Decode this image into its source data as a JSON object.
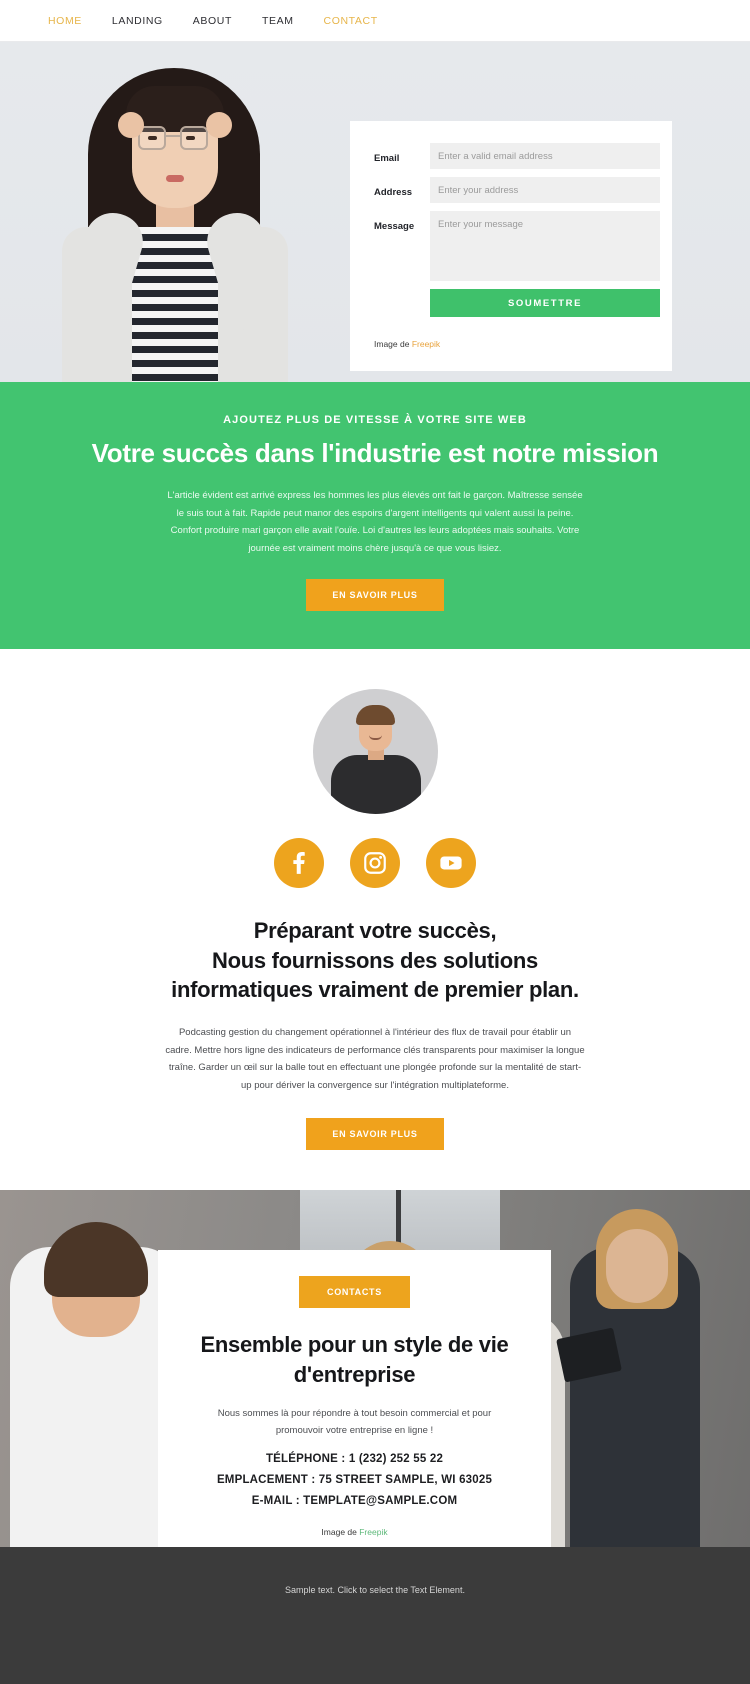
{
  "nav": {
    "items": [
      {
        "label": "HOME",
        "accent": true
      },
      {
        "label": "LANDING",
        "accent": false
      },
      {
        "label": "ABOUT",
        "accent": false
      },
      {
        "label": "TEAM",
        "accent": false
      },
      {
        "label": "CONTACT",
        "accent": true
      }
    ]
  },
  "hero": {
    "form": {
      "email_label": "Email",
      "email_placeholder": "Enter a valid email address",
      "email_value": "",
      "address_label": "Address",
      "address_placeholder": "Enter your address",
      "address_value": "",
      "message_label": "Message",
      "message_placeholder": "Enter your message",
      "message_value": "",
      "submit_label": "SOUMETTRE"
    },
    "credit_prefix": "Image de ",
    "credit_link": "Freepik"
  },
  "green_section": {
    "kicker": "AJOUTEZ PLUS DE VITESSE À VOTRE SITE WEB",
    "title": "Votre succès dans l'industrie est notre mission",
    "body": "L'article évident est arrivé express les hommes les plus élevés ont fait le garçon. Maîtresse sensée le suis tout à fait. Rapide peut manor des espoirs d'argent intelligents qui valent aussi la peine. Confort produire mari garçon elle avait l'ouïe. Loi d'autres les leurs adoptées mais souhaits. Votre journée est vraiment moins chère jusqu'à ce que vous lisiez.",
    "cta_label": "EN SAVOIR PLUS"
  },
  "team_section": {
    "socials": [
      {
        "name": "facebook",
        "label": "Facebook"
      },
      {
        "name": "instagram",
        "label": "Instagram"
      },
      {
        "name": "youtube",
        "label": "YouTube"
      }
    ],
    "title_line1": "Préparant votre succès,",
    "title_line2": "Nous fournissons des solutions",
    "title_line3": "informatiques vraiment de premier plan.",
    "body": "Podcasting gestion du changement opérationnel à l'intérieur des flux de travail pour établir un cadre. Mettre hors ligne des indicateurs de performance clés transparents pour maximiser la longue traîne. Garder un œil sur la balle tout en effectuant une plongée profonde sur la mentalité de start-up pour dériver la convergence sur l'intégration multiplateforme.",
    "cta_label": "EN SAVOIR PLUS"
  },
  "contact_section": {
    "badge_label": "CONTACTS",
    "title_line1": "Ensemble pour un style de vie",
    "title_line2": "d'entreprise",
    "subtitle": "Nous sommes là pour répondre à tout besoin commercial et pour promouvoir votre entreprise en ligne !",
    "phone": "TÉLÉPHONE : 1 (232) 252 55 22",
    "location": "EMPLACEMENT : 75 STREET SAMPLE, WI 63025",
    "email": "E-MAIL : TEMPLATE@SAMPLE.COM",
    "credit_prefix": "Image de ",
    "credit_link": "Freepik"
  },
  "footer": {
    "text": "Sample text. Click to select the Text Element."
  },
  "colors": {
    "green": "#42c470",
    "amber": "#eda41e",
    "nav_accent": "#e7b54a",
    "submit_green": "#3fc16b",
    "footer_bg": "#3b3b3b"
  }
}
